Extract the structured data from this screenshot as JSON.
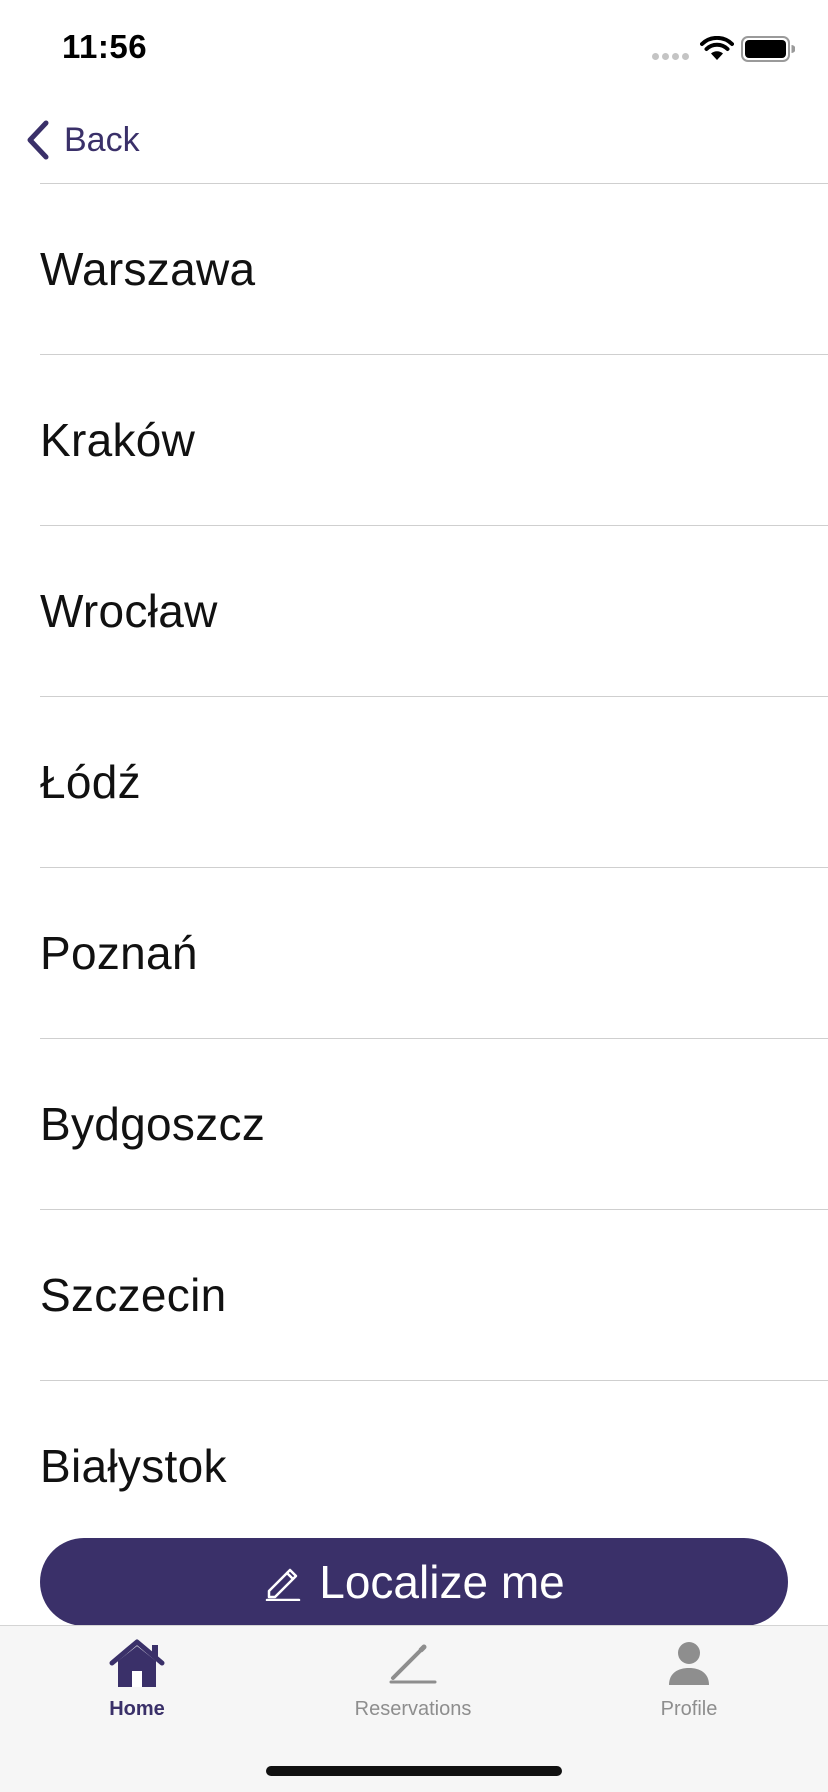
{
  "status_bar": {
    "time": "11:56"
  },
  "nav": {
    "back_label": "Back"
  },
  "cities": [
    {
      "name": "Warszawa"
    },
    {
      "name": "Kraków"
    },
    {
      "name": "Wrocław"
    },
    {
      "name": "Łódź"
    },
    {
      "name": "Poznań"
    },
    {
      "name": "Bydgoszcz"
    },
    {
      "name": "Szczecin"
    },
    {
      "name": "Białystok"
    }
  ],
  "localize_button": {
    "label": "Localize me",
    "icon": "pencil-icon"
  },
  "tab_bar": {
    "tabs": [
      {
        "label": "Home",
        "icon": "house-icon",
        "active": true
      },
      {
        "label": "Reservations",
        "icon": "pen-icon",
        "active": false
      },
      {
        "label": "Profile",
        "icon": "person-icon",
        "active": false
      }
    ]
  },
  "colors": {
    "accent": "#3a3069",
    "inactive": "#8e8e8e",
    "divider": "#cfcfcf",
    "tab_bar_bg": "#f6f6f6"
  }
}
